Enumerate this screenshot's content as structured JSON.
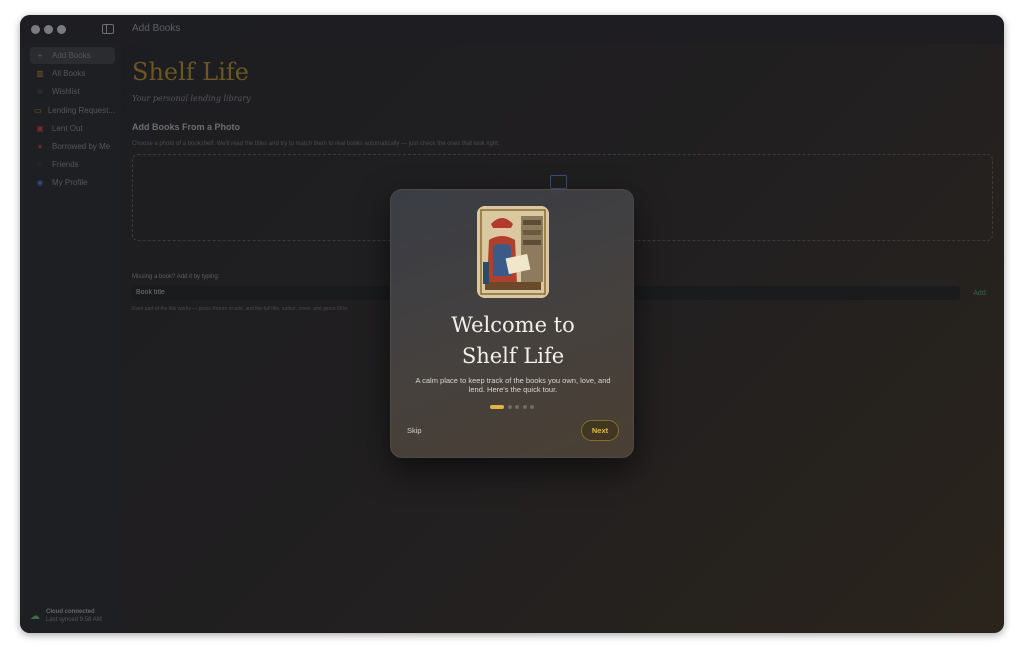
{
  "window": {
    "title": "Add Books"
  },
  "sidebar": {
    "items": [
      {
        "label": "Add Books",
        "icon": "plus-icon",
        "glyph": "+",
        "color": "#3a6a4c",
        "active": true
      },
      {
        "label": "All Books",
        "icon": "books-icon",
        "glyph": "▥",
        "color": "#7a5428",
        "active": false
      },
      {
        "label": "Wishlist",
        "icon": "star-icon",
        "glyph": "☆",
        "color": "#6a5a2a",
        "active": false
      },
      {
        "label": "Lending Request...",
        "icon": "inbox-icon",
        "glyph": "▭",
        "color": "#7a6220",
        "active": false
      },
      {
        "label": "Lent Out",
        "icon": "gift-icon",
        "glyph": "▣",
        "color": "#7a2a2a",
        "active": false
      },
      {
        "label": "Borrowed by Me",
        "icon": "bookmark-icon",
        "glyph": "●",
        "color": "#6a2a2a",
        "active": false
      },
      {
        "label": "Friends",
        "icon": "people-icon",
        "glyph": "◌",
        "color": "#4a4b50",
        "active": false
      },
      {
        "label": "My Profile",
        "icon": "person-icon",
        "glyph": "◉",
        "color": "#2e4a78",
        "active": false
      }
    ],
    "cloud": {
      "title": "Cloud connected",
      "subtitle": "Last synced 9:58 AM",
      "icon": "cloud-icon"
    }
  },
  "main": {
    "app_title": "Shelf Life",
    "app_subtitle": "Your personal lending library",
    "section_title": "Add Books From a Photo",
    "section_desc": "Choose a photo of a bookshelf. We'll read the titles and try to match them to real books automatically — just check the ones that look right.",
    "missing_label": "Missing a book? Add it by typing:",
    "input_placeholder": "Book title",
    "add_label": "Add",
    "hint": "Even part of the title works — press Return to add, and the full title, author, cover, and genre fill in."
  },
  "modal": {
    "title_line1": "Welcome to",
    "title_line2": "Shelf Life",
    "description": "A calm place to keep track of the books you own, love, and lend. Here's the quick tour.",
    "page_count": 5,
    "current_page": 1,
    "skip_label": "Skip",
    "next_label": "Next"
  },
  "colors": {
    "accent": "#e3b43a",
    "brand_title": "#6b5624",
    "modal_bg": "#45413e"
  }
}
